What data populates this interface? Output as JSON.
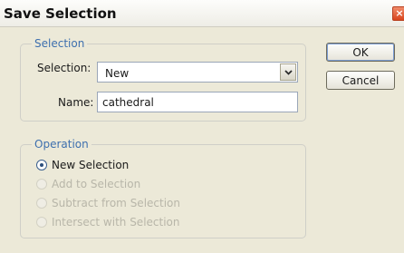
{
  "window": {
    "title": "Save Selection",
    "close_glyph": "×"
  },
  "selection_group": {
    "legend": "Selection",
    "selection_label": "Selection:",
    "selection_value": "New",
    "name_label": "Name:",
    "name_value": "cathedral"
  },
  "operation_group": {
    "legend": "Operation",
    "options": [
      {
        "label": "New Selection",
        "checked": true,
        "enabled": true
      },
      {
        "label": "Add to Selection",
        "checked": false,
        "enabled": false
      },
      {
        "label": "Subtract from Selection",
        "checked": false,
        "enabled": false
      },
      {
        "label": "Intersect with Selection",
        "checked": false,
        "enabled": false
      }
    ]
  },
  "buttons": {
    "ok_label": "OK",
    "cancel_label": "Cancel"
  },
  "colors": {
    "legend_text": "#3d6fae",
    "disabled_text": "#b8b6a9",
    "dialog_bg": "#ece9d8"
  },
  "icons": {
    "close": "close-icon",
    "dropdown": "chevron-down-icon"
  }
}
